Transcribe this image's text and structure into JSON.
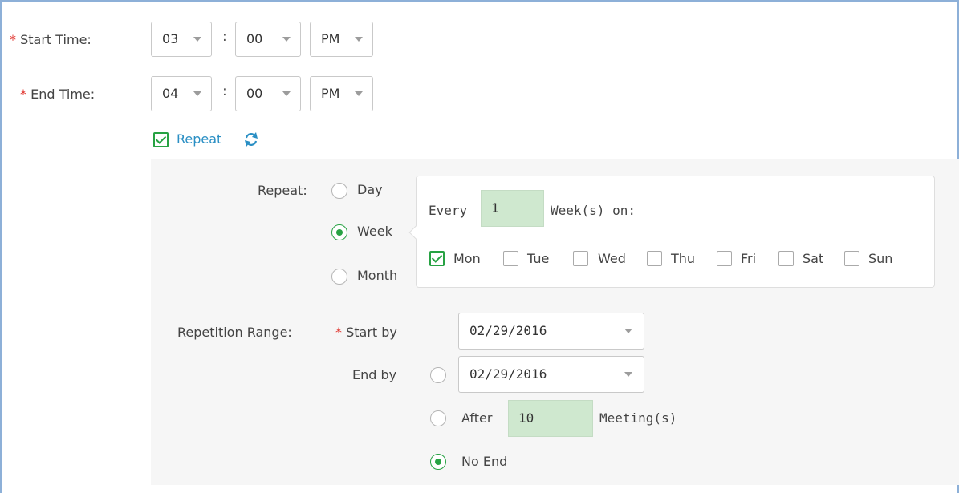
{
  "required_mark": "*",
  "start_time": {
    "label": "Start Time:",
    "hour": "03",
    "separator": ":",
    "minute": "00",
    "ampm": "PM"
  },
  "end_time": {
    "label": "End Time:",
    "hour": "04",
    "separator": ":",
    "minute": "00",
    "ampm": "PM"
  },
  "repeat_toggle": {
    "label": "Repeat",
    "checked": true,
    "icon": "refresh-icon"
  },
  "repeat": {
    "label": "Repeat:",
    "options": [
      "Day",
      "Week",
      "Month"
    ],
    "selected": "Week",
    "every_label": "Every",
    "every_value": "1",
    "unit_label": "Week(s) on:",
    "days": [
      {
        "label": "Mon",
        "checked": true
      },
      {
        "label": "Tue",
        "checked": false
      },
      {
        "label": "Wed",
        "checked": false
      },
      {
        "label": "Thu",
        "checked": false
      },
      {
        "label": "Fri",
        "checked": false
      },
      {
        "label": "Sat",
        "checked": false
      },
      {
        "label": "Sun",
        "checked": false
      }
    ]
  },
  "repetition_range": {
    "label": "Repetition Range:",
    "start_by_label": "Start by",
    "start_by_value": "02/29/2016",
    "end_by_label": "End by",
    "end_by_value": "02/29/2016",
    "after_label": "After",
    "after_value": "10",
    "meetings_label": "Meeting(s)",
    "no_end_label": "No End",
    "selected": "No End"
  },
  "colors": {
    "required": "#e0322b",
    "accent_green": "#27a243",
    "link_blue": "#2a8fc4",
    "input_green": "#cfe8cf",
    "frame_border": "#8db0d8"
  }
}
